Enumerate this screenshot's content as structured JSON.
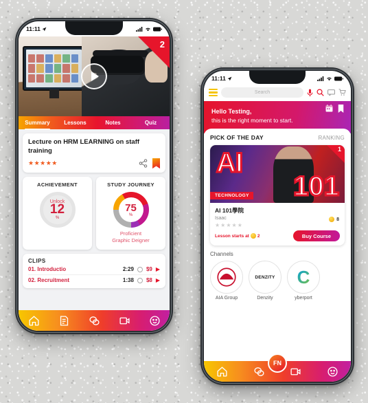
{
  "phone1": {
    "status": {
      "time": "11:11",
      "location_icon": "location-arrow-icon",
      "signal_icon": "signal-icon",
      "wifi_icon": "wifi-icon",
      "battery_icon": "battery-icon"
    },
    "hero": {
      "badge_number": "2",
      "play_icon": "play-icon"
    },
    "tabs": [
      {
        "label": "Summary",
        "active": true
      },
      {
        "label": "Lessons",
        "active": false
      },
      {
        "label": "Notes",
        "active": false
      },
      {
        "label": "Quiz",
        "active": false
      }
    ],
    "lecture": {
      "title": "Lecture on HRM LEARNING on staff training",
      "stars": "★★★★★",
      "share_icon": "share-icon",
      "bookmark_icon": "bookmark-icon"
    },
    "achievement": {
      "title": "ACHIEVEMENT",
      "label": "Unlock",
      "value": "12",
      "unit": "%"
    },
    "study_journey": {
      "title": "STUDY JOURNEY",
      "value": "75",
      "unit": "%",
      "sub_line1": "Proficient",
      "sub_line2": "Graphic Deigner"
    },
    "clips": {
      "title": "CLIPS",
      "rows": [
        {
          "name": "01. Introductio",
          "time": "2:29",
          "clock_icon": "clock-icon",
          "price": "$9",
          "play_icon": "play-triangle-icon"
        },
        {
          "name": "02. Recruitment",
          "time": "1:38",
          "clock_icon": "clock-icon",
          "price": "$8",
          "play_icon": "play-triangle-icon"
        }
      ]
    },
    "nav": [
      {
        "icon": "home-icon"
      },
      {
        "icon": "document-icon"
      },
      {
        "icon": "chat-icon"
      },
      {
        "icon": "video-icon"
      },
      {
        "icon": "smiley-icon"
      }
    ]
  },
  "phone2": {
    "status": {
      "time": "11:11",
      "location_icon": "location-arrow-icon",
      "signal_icon": "signal-icon",
      "wifi_icon": "wifi-icon",
      "battery_icon": "battery-icon"
    },
    "topbar": {
      "menu_icon": "hamburger-icon",
      "search_placeholder": "Search",
      "mic_icon": "microphone-icon",
      "search_icon": "search-icon",
      "chat_icon": "chat-icon",
      "cart_icon": "cart-icon"
    },
    "banner": {
      "line1": "Hello Testing,",
      "line2": "this is the right moment to start.",
      "calendar_icon": "calendar-icon",
      "bookmark_icon": "bookmark-icon"
    },
    "pick": {
      "title": "PICK OF THE DAY",
      "link": "RANKING"
    },
    "course": {
      "art_ai": "AI",
      "art_101": "101",
      "category": "TECHNOLOGY",
      "rank": "1",
      "name": "AI 101學院",
      "author": "Isaac",
      "stars": "★★★★★",
      "lesson_label": "Lesson starts at",
      "lesson_coins": "2",
      "coin_count": "8",
      "buy_label": "Buy Course"
    },
    "channels_title": "Channels",
    "channels": [
      {
        "label": "AIA Group",
        "logo": "AIA"
      },
      {
        "label": "Denzity",
        "logo": "DENZITY"
      },
      {
        "label": "yberport",
        "logo": "C"
      }
    ],
    "nav": [
      {
        "icon": "home-icon"
      },
      {
        "icon": "chat-icon"
      },
      {
        "icon": "video-icon"
      },
      {
        "icon": "smiley-icon"
      }
    ],
    "fab_label": "FN"
  },
  "colors": {
    "red": "#e6152b",
    "magenta": "#c2189a",
    "orange": "#f58220",
    "yellow": "#f7c600"
  }
}
